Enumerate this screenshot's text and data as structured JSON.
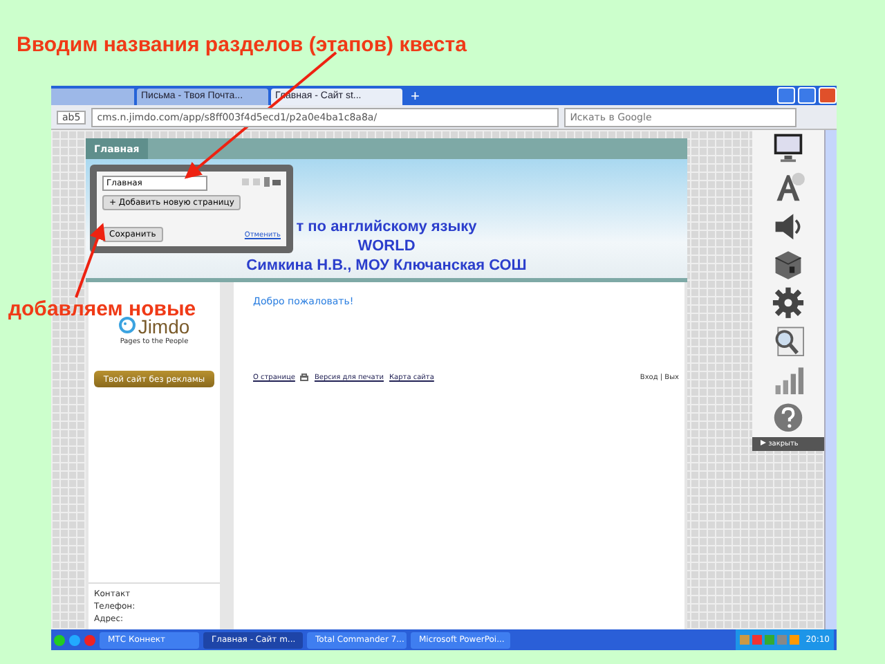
{
  "annotations": [
    {
      "kind": "title",
      "text": "Вводим названия разделов (этапов) квеста"
    },
    {
      "kind": "side",
      "text": "добавляем новые"
    }
  ],
  "browser": {
    "tabs": [
      {
        "label": "Письма - Твоя Почта...",
        "selected": false
      },
      {
        "label": "Главная - Сайт st...",
        "selected": true
      }
    ],
    "new_tab": "+",
    "identity": "ab5",
    "url": "cms.n.jimdo.com/app/s8ff003f4d5ecd1/p2a0e4ba1c8a8a/",
    "search_placeholder": "Искать в Google"
  },
  "site": {
    "nav": [
      {
        "label": "Главная",
        "selected": true
      }
    ],
    "header_lines": [
      "т по английскому языку",
      "WORLD",
      "Симкина Н.В., МОУ Ключанская СОШ"
    ],
    "editor": {
      "input_value": "Главная",
      "add_button": "+ Добавить новую страницу",
      "save_button": "Сохранить",
      "cancel_link": "Отменить"
    },
    "logo": {
      "name": "Jimdo",
      "tagline": "Pages to the People"
    },
    "promo_button": "Твой сайт без рекламы",
    "welcome": "Добро пожаловать!",
    "footer_links": [
      "О странице",
      "Версия для печати",
      "Карта сайта"
    ],
    "login": "Вход | Вых",
    "contact": {
      "heading": "Контакт",
      "lines": [
        "Телефон:",
        "Адрес:"
      ]
    }
  },
  "side_panel": {
    "close": "закрыть"
  },
  "taskbar": {
    "buttons": [
      {
        "label": "МТС Коннект",
        "selected": false
      },
      {
        "label": "Главная - Сайт m...",
        "selected": true
      },
      {
        "label": "Total Commander 7...",
        "selected": false
      },
      {
        "label": "Microsoft PowerPoi...",
        "selected": false
      }
    ],
    "clock": "20:10"
  }
}
